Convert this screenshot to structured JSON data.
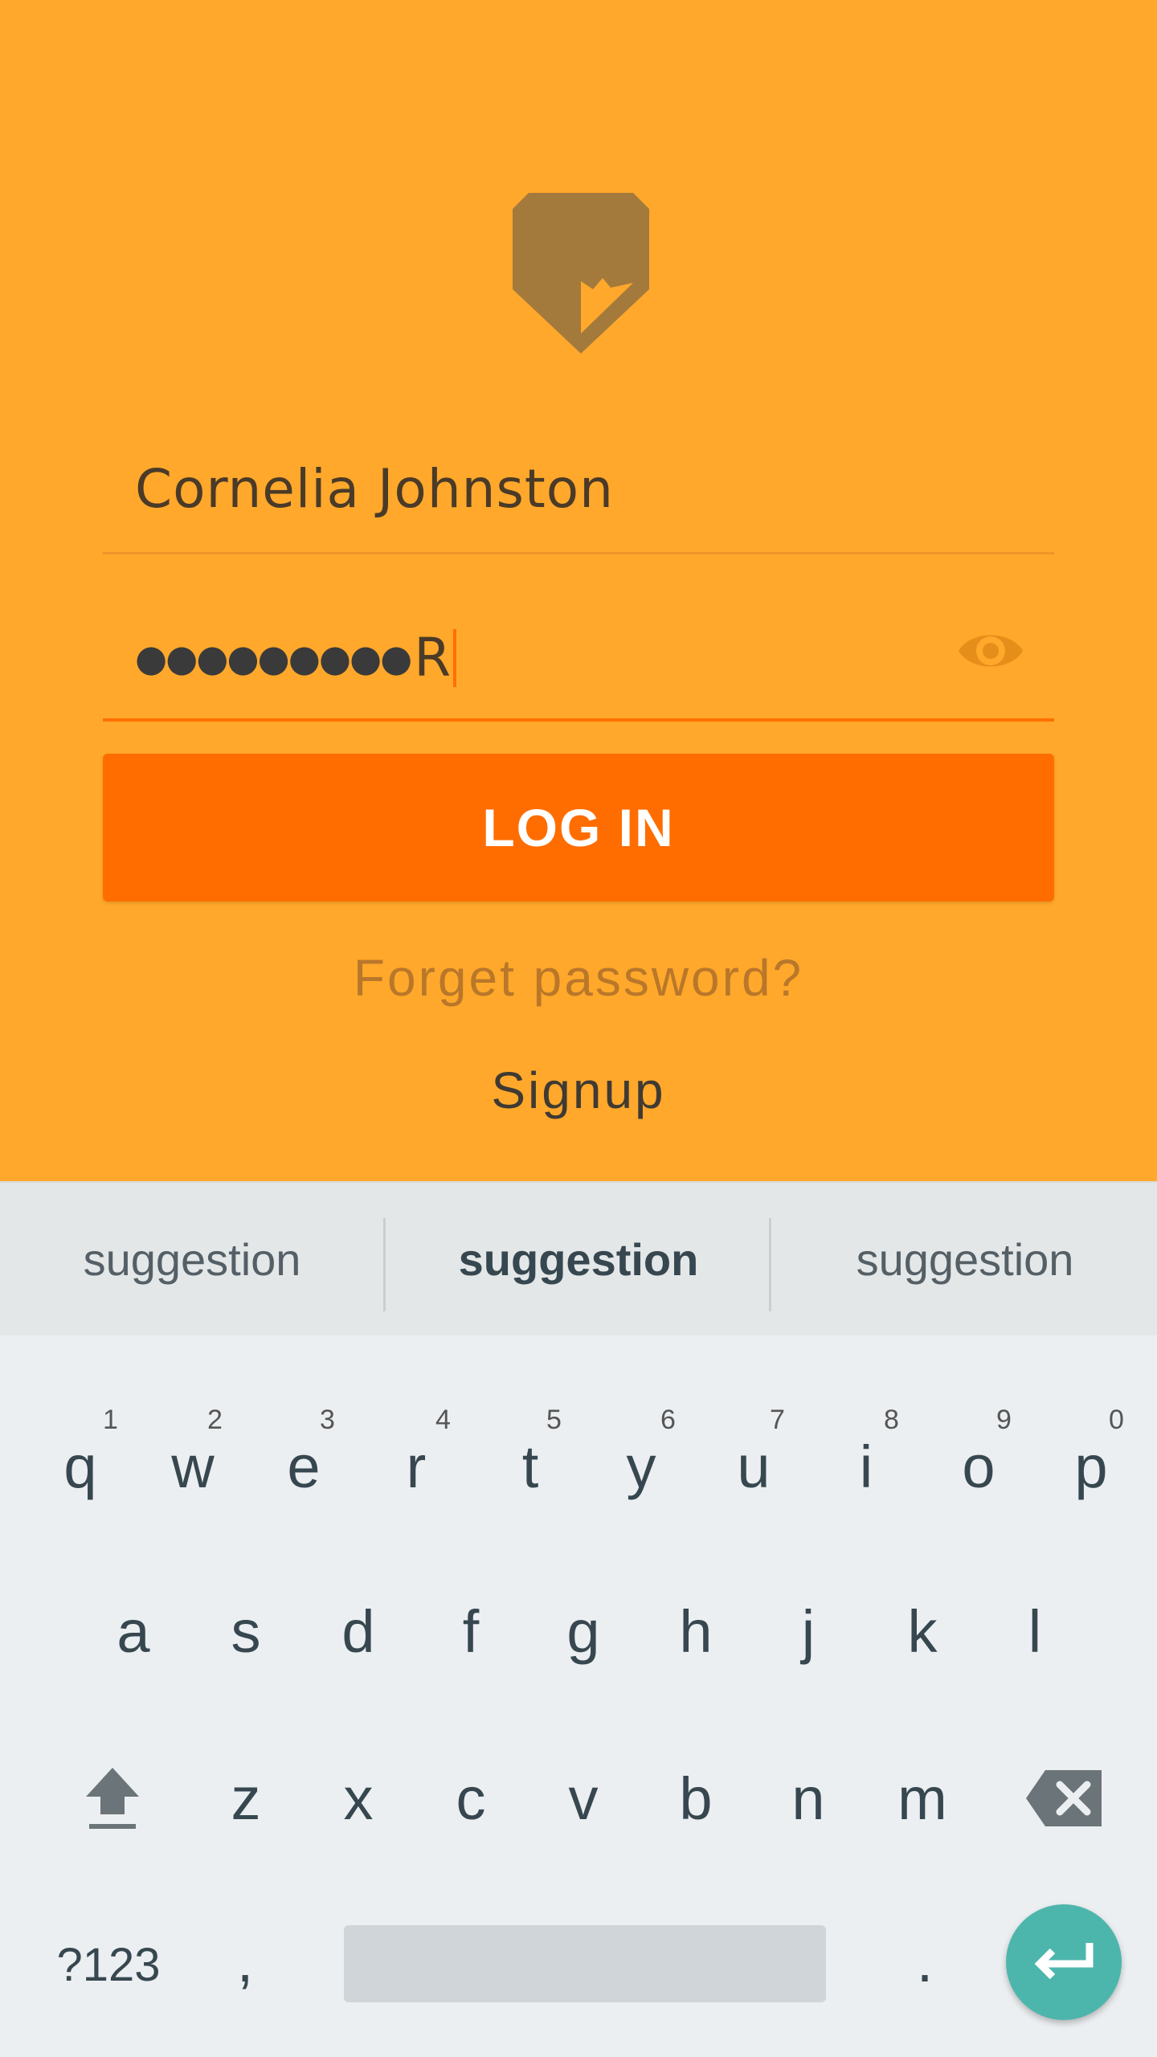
{
  "app": {
    "brand_color": "#FFA82B",
    "accent_color": "#FF6D00",
    "logo_icon": "pencil-tag-icon"
  },
  "login": {
    "username_value": "Cornelia Johnston",
    "password_masked": "●●●●●●●●●",
    "password_last_char": "R",
    "show_password_icon": "eye-icon",
    "login_label": "LOG IN",
    "forgot_label": "Forget password?",
    "signup_label": "Signup"
  },
  "keyboard": {
    "suggestions": [
      "suggestion",
      "suggestion",
      "suggestion"
    ],
    "row1": [
      {
        "key": "q",
        "hint": "1"
      },
      {
        "key": "w",
        "hint": "2"
      },
      {
        "key": "e",
        "hint": "3"
      },
      {
        "key": "r",
        "hint": "4"
      },
      {
        "key": "t",
        "hint": "5"
      },
      {
        "key": "y",
        "hint": "6"
      },
      {
        "key": "u",
        "hint": "7"
      },
      {
        "key": "i",
        "hint": "8"
      },
      {
        "key": "o",
        "hint": "9"
      },
      {
        "key": "p",
        "hint": "0"
      }
    ],
    "row2": [
      "a",
      "s",
      "d",
      "f",
      "g",
      "h",
      "j",
      "k",
      "l"
    ],
    "row3": [
      "z",
      "x",
      "c",
      "v",
      "b",
      "n",
      "m"
    ],
    "symbols_label": "?123",
    "comma_label": ",",
    "period_label": ".",
    "shift_icon": "shift-icon",
    "backspace_icon": "backspace-icon",
    "enter_icon": "enter-icon",
    "enter_color": "#4DB6AC"
  }
}
